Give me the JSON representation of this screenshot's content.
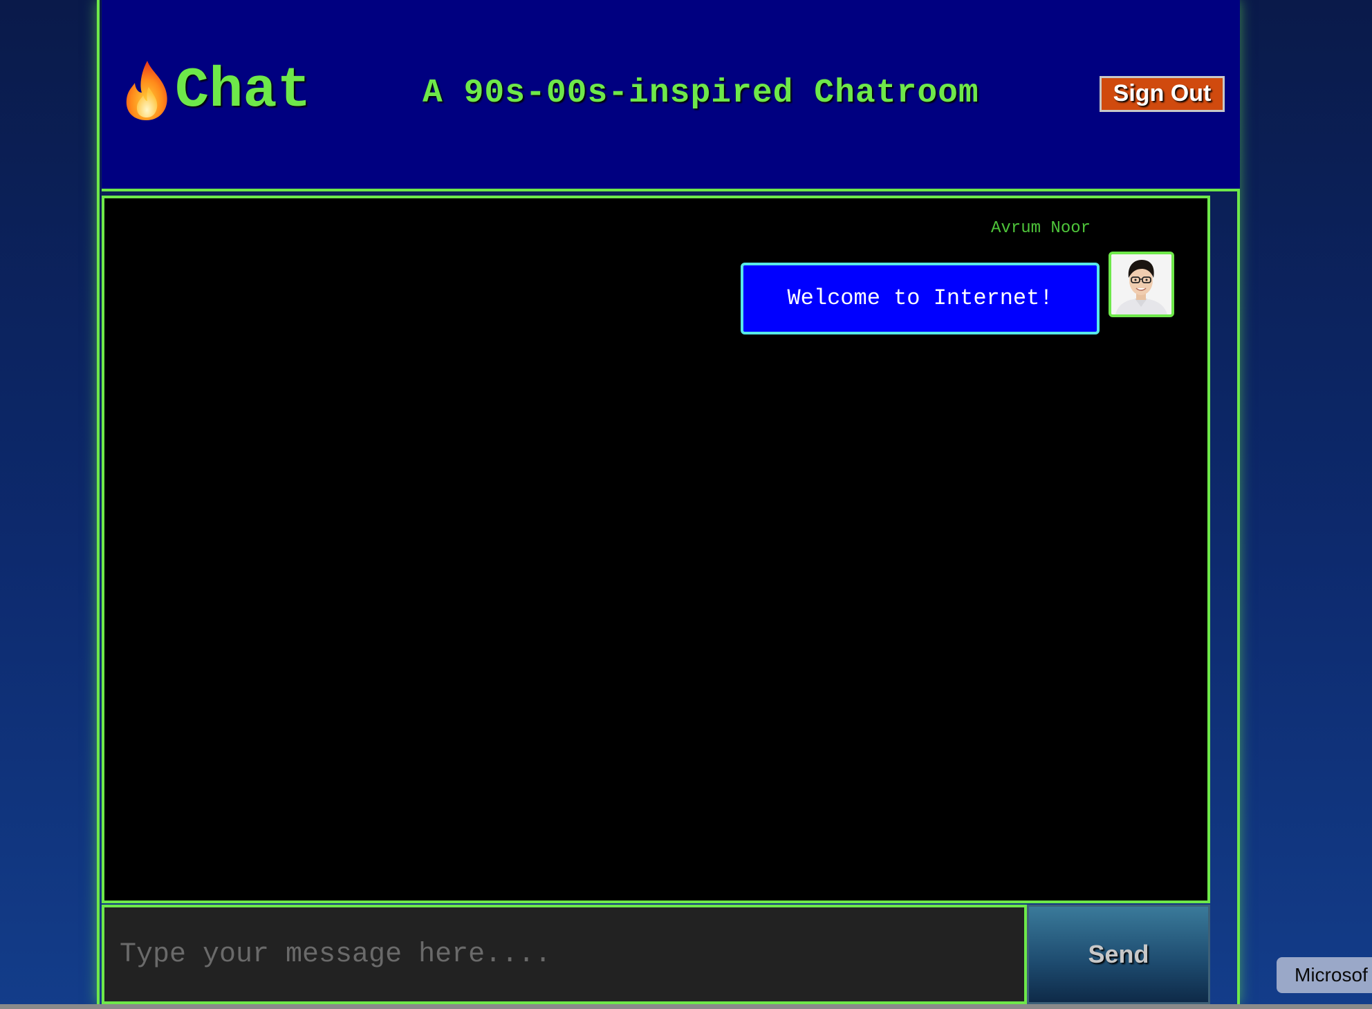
{
  "header": {
    "logo_text": "Chat",
    "logo_icon": "fire-icon",
    "tagline": "A 90s-00s-inspired Chatroom",
    "signout_label": "Sign Out"
  },
  "chat": {
    "messages": [
      {
        "username": "Avrum Noor",
        "text": "Welcome to Internet!",
        "avatar": "user-avatar"
      }
    ]
  },
  "composer": {
    "placeholder": "Type your message here....",
    "send_label": "Send"
  },
  "tooltip": {
    "text": "Microsof"
  },
  "colors": {
    "accent": "#6ee84a",
    "header_bg": "#000080",
    "bubble_bg": "#0000ff",
    "bubble_border": "#58e8e8",
    "signout_bg": "#d04a0e"
  }
}
